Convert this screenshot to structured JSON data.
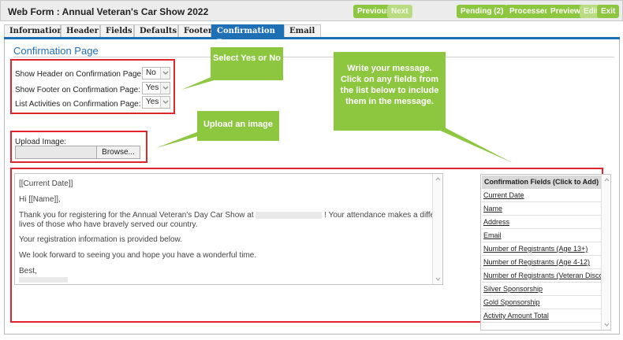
{
  "window": {
    "title": "Web Form : Annual Veteran's Car Show 2022",
    "nav": {
      "previous": "Previous",
      "next": "Next"
    },
    "actions": {
      "pending": "Pending (2)",
      "processed": "Processed",
      "preview": "Preview",
      "edit": "Edit",
      "exit": "Exit"
    }
  },
  "tabs": [
    "Information",
    "Header",
    "Fields",
    "Defaults",
    "Footer",
    "Confirmation Page",
    "Email"
  ],
  "active_tab": "Confirmation Page",
  "page": {
    "title": "Confirmation Page",
    "settings": [
      {
        "label": "Show Header on Confirmation Page:",
        "value": "No"
      },
      {
        "label": "Show Footer on Confirmation Page:",
        "value": "Yes"
      },
      {
        "label": "List Activities on Confirmation Page:",
        "value": "Yes"
      }
    ],
    "upload": {
      "label": "Upload Image:",
      "browse": "Browse..."
    },
    "message_lines": [
      "[[Current Date]]",
      "Hi [[Name]],",
      "Thank you for registering for the Annual Veteran's Day Car Show at",
      "! Your attendance makes a difference in the",
      "lives of those who have bravely served our country.",
      "Your registration information is provided below.",
      "We look forward to seeing you and hope you have a wonderful time.",
      "Best,"
    ],
    "fields_header": "Confirmation Fields (Click to Add)",
    "fields": [
      "Current Date",
      "Name",
      "Address",
      "Email",
      "Number of Registrants (Age 13+)",
      "Number of Registrants (Age 4-12)",
      "Number of Registrants (Veteran Discount)",
      "Silver Sponsorship",
      "Gold Sponsorship",
      "Activity Amount Total"
    ]
  },
  "callouts": {
    "select": "Select Yes or No",
    "upload": "Upload an image",
    "message": [
      "Write your message.",
      "Click on any fields from",
      "the list below to include",
      "them in the message."
    ]
  },
  "colors": {
    "accent_green": "#8dc63f",
    "tab_blue": "#1f6fb5",
    "highlight_red": "#e0252b"
  }
}
